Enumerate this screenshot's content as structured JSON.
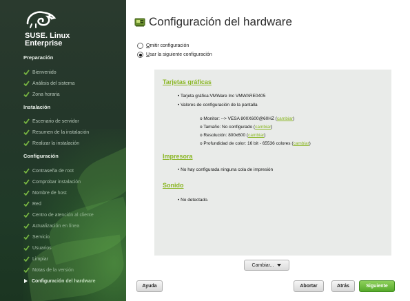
{
  "sidebar": {
    "brand_line1": "SUSE. Linux",
    "brand_line2": "Enterprise",
    "sections": {
      "preparacion": "Preparación",
      "instalacion": "Instalación",
      "configuracion": "Configuración"
    },
    "preparation_items": [
      "Bienvenido",
      "Análisis del sistema",
      "Zona horaria"
    ],
    "installation_items": [
      "Escenario de servidor",
      "Resumen de la instalación",
      "Realizar la instalación"
    ],
    "configuration_items": [
      "Contraseña de root",
      "Comprobar instalación",
      "Nombre de host",
      "Red",
      "Centro de atención al cliente",
      "Actualización en línea",
      "Servicio",
      "Usuarios",
      "Limpiar",
      "Notas de la versión"
    ],
    "active_item": "Configuración del hardware"
  },
  "main": {
    "title": "Configuración del hardware",
    "options": {
      "skip_label": "Omitir configuración",
      "use_label": "Usar la siguiente configuración",
      "selected": "use"
    },
    "graphics": {
      "heading": "Tarjetas gráficas",
      "card": "• Tarjeta gráfica:VMWare Inc VMWARE0405",
      "display_values": "• Valores de configuración de la pantalla",
      "monitor": "o Monitor: --> VESA 800X600@60HZ (",
      "size": "o Tamaño: No configurado (",
      "resolution": "o Resolución: 800x600 (",
      "depth": "o Profundidad de color: 16 bit - 65536 colores (",
      "change_link": "cambiar",
      "close_paren": ")"
    },
    "printer": {
      "heading": "Impresora",
      "text": "• No hay configurada ninguna cola de impresión"
    },
    "sound": {
      "heading": "Sonido",
      "text": "• No detectado."
    },
    "change_button": "Cambiar..."
  },
  "footer": {
    "help": "Ayuda",
    "abort": "Abortar",
    "back": "Atrás",
    "next": "Siguiente"
  },
  "colors": {
    "accent_green": "#8ab624",
    "next_button": "#55a92a",
    "sidebar_bg": "#24372a"
  }
}
